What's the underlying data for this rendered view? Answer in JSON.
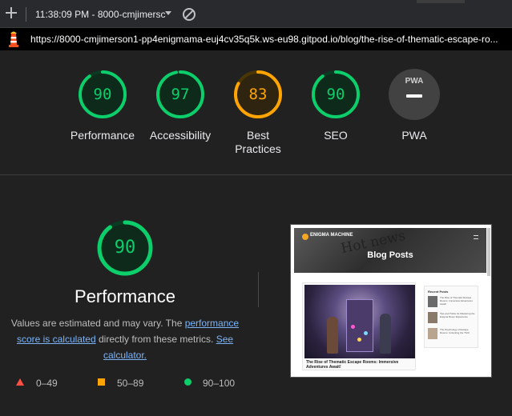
{
  "toolbar": {
    "time_label": "11:38:09 PM - 8000-cmjimersc"
  },
  "url": {
    "text": "https://8000-cmjimerson1-pp4enigmama-euj4cv35q5k.ws-eu98.gitpod.io/blog/the-rise-of-thematic-escape-ro..."
  },
  "gauges": [
    {
      "label": "Performance",
      "score": "90",
      "fraction": 0.9,
      "color": "#0cce6b",
      "track": "#0b3a22",
      "fill": "#0e2a1b"
    },
    {
      "label": "Accessibility",
      "score": "97",
      "fraction": 0.97,
      "color": "#0cce6b",
      "track": "#0b3a22",
      "fill": "#0e2a1b"
    },
    {
      "label": "Best Practices",
      "score": "83",
      "fraction": 0.83,
      "color": "#ffa400",
      "track": "#4a3505",
      "fill": "#2e2410"
    },
    {
      "label": "SEO",
      "score": "90",
      "fraction": 0.9,
      "color": "#0cce6b",
      "track": "#0b3a22",
      "fill": "#0e2a1b"
    }
  ],
  "pwa": {
    "label": "PWA",
    "badge": "PWA"
  },
  "performance": {
    "score": "90",
    "fraction": 0.9,
    "title": "Performance",
    "desc_prefix": "Values are estimated and may vary. The ",
    "desc_link1": "performance score is calculated",
    "desc_mid": " directly from these metrics. ",
    "desc_link2": "See calculator."
  },
  "legend": [
    {
      "range": "0–49",
      "color": "#ff4e42"
    },
    {
      "range": "50–89",
      "color": "#ffa400"
    },
    {
      "range": "90–100",
      "color": "#0cce6b"
    }
  ],
  "thumbnail": {
    "logo": "ENIGMA MACHINE",
    "hero_text": "Hot news",
    "title": "Blog Posts",
    "card_caption": "The Rise of Thematic Escape Rooms: Immersive Adventures Await!",
    "sidebar_title": "Recent Posts",
    "sidebar_items": [
      "The Rise of Thematic Escape Rooms: Immersive Adventures Await!",
      "Tips and Tricks for Mastering the Enigma Room Experience",
      "The Psychology of Escape Rooms: Unlocking the Thrill"
    ]
  },
  "colors": {
    "background": "#212121",
    "good": "#0cce6b",
    "average": "#ffa400",
    "poor": "#ff4e42",
    "link": "#7cb4f7"
  }
}
